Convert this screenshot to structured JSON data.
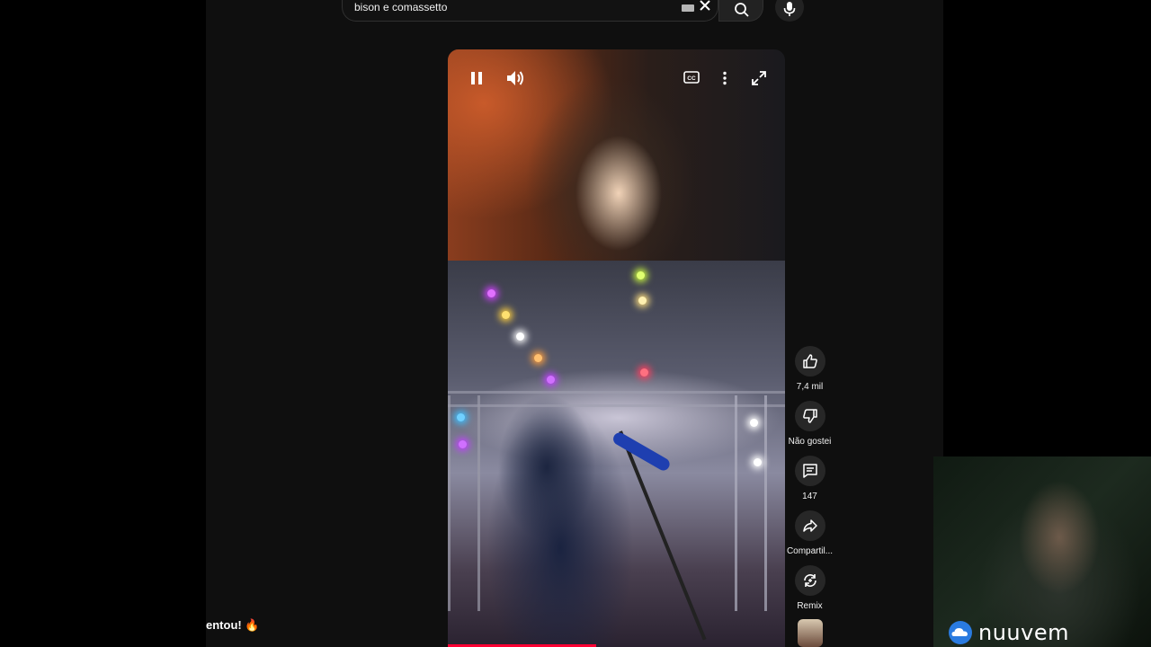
{
  "search": {
    "query": "bison e comassetto"
  },
  "player": {
    "progress_fraction": 0.44
  },
  "actions": {
    "like_count": "7,4 mil",
    "dislike_label": "Não gostei",
    "comments_count": "147",
    "share_label": "Compartil...",
    "remix_label": "Remix"
  },
  "chat": {
    "message": "entou! 🔥"
  },
  "overlay": {
    "brand": "nuuvem"
  },
  "colors": {
    "progress": "#ff0033",
    "background": "#0f0f0f",
    "button_bg": "#272727"
  }
}
